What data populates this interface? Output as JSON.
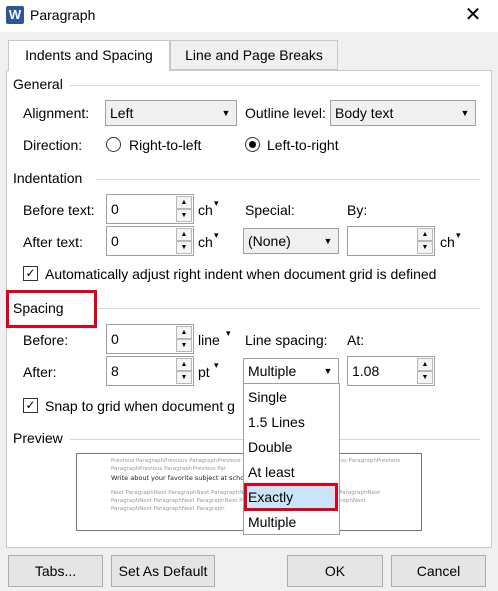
{
  "window": {
    "title": "Paragraph",
    "app_icon_letter": "W"
  },
  "tabs": [
    {
      "label": "Indents and Spacing",
      "active": true
    },
    {
      "label": "Line and Page Breaks",
      "active": false
    }
  ],
  "general": {
    "title": "General",
    "alignment_label": "Alignment:",
    "alignment_value": "Left",
    "outline_label": "Outline level:",
    "outline_value": "Body text",
    "direction_label": "Direction:",
    "rtl_label": "Right-to-left",
    "ltr_label": "Left-to-right"
  },
  "indentation": {
    "title": "Indentation",
    "before_label": "Before text:",
    "before_value": "0",
    "before_unit": "ch",
    "after_label": "After text:",
    "after_value": "0",
    "after_unit": "ch",
    "special_label": "Special:",
    "special_value": "(None)",
    "by_label": "By:",
    "by_value": "",
    "by_unit": "ch",
    "auto_adjust_label": "Automatically adjust right indent when document grid is defined"
  },
  "spacing": {
    "title": "Spacing",
    "before_label": "Before:",
    "before_value": "0",
    "before_unit": "line",
    "after_label": "After:",
    "after_value": "8",
    "after_unit": "pt",
    "line_spacing_label": "Line spacing:",
    "line_spacing_value": "Multiple",
    "at_label": "At:",
    "at_value": "1.08",
    "snap_label": "Snap to grid when document g"
  },
  "line_spacing_options": [
    "Single",
    "1.5 Lines",
    "Double",
    "At least",
    "Exactly",
    "Multiple"
  ],
  "preview": {
    "title": "Preview",
    "lines": [
      "Previous ParagraphPrevious ParagraphPrevious ParagraphPrevious ParagraphPrevious ParagraphPrevious",
      "ParagraphPrevious ParagraphPrevious Par",
      "Write about your favorite subject at school",
      "Next ParagraphNext ParagraphNext ParagraphNext ParagraphNext ParagraphNext ParagraphNext",
      "ParagraphNext ParagraphNext ParagraphNext ParagraphNext ParagraphNext ParagraphNext",
      "ParagraphNext ParagraphNext Paragraph"
    ]
  },
  "buttons": {
    "tabs": "Tabs...",
    "set_default": "Set As Default",
    "ok": "OK",
    "cancel": "Cancel"
  },
  "colors": {
    "highlight_red": "#e0001b",
    "selection_blue": "#cce4f7",
    "word_blue": "#2b579a"
  }
}
